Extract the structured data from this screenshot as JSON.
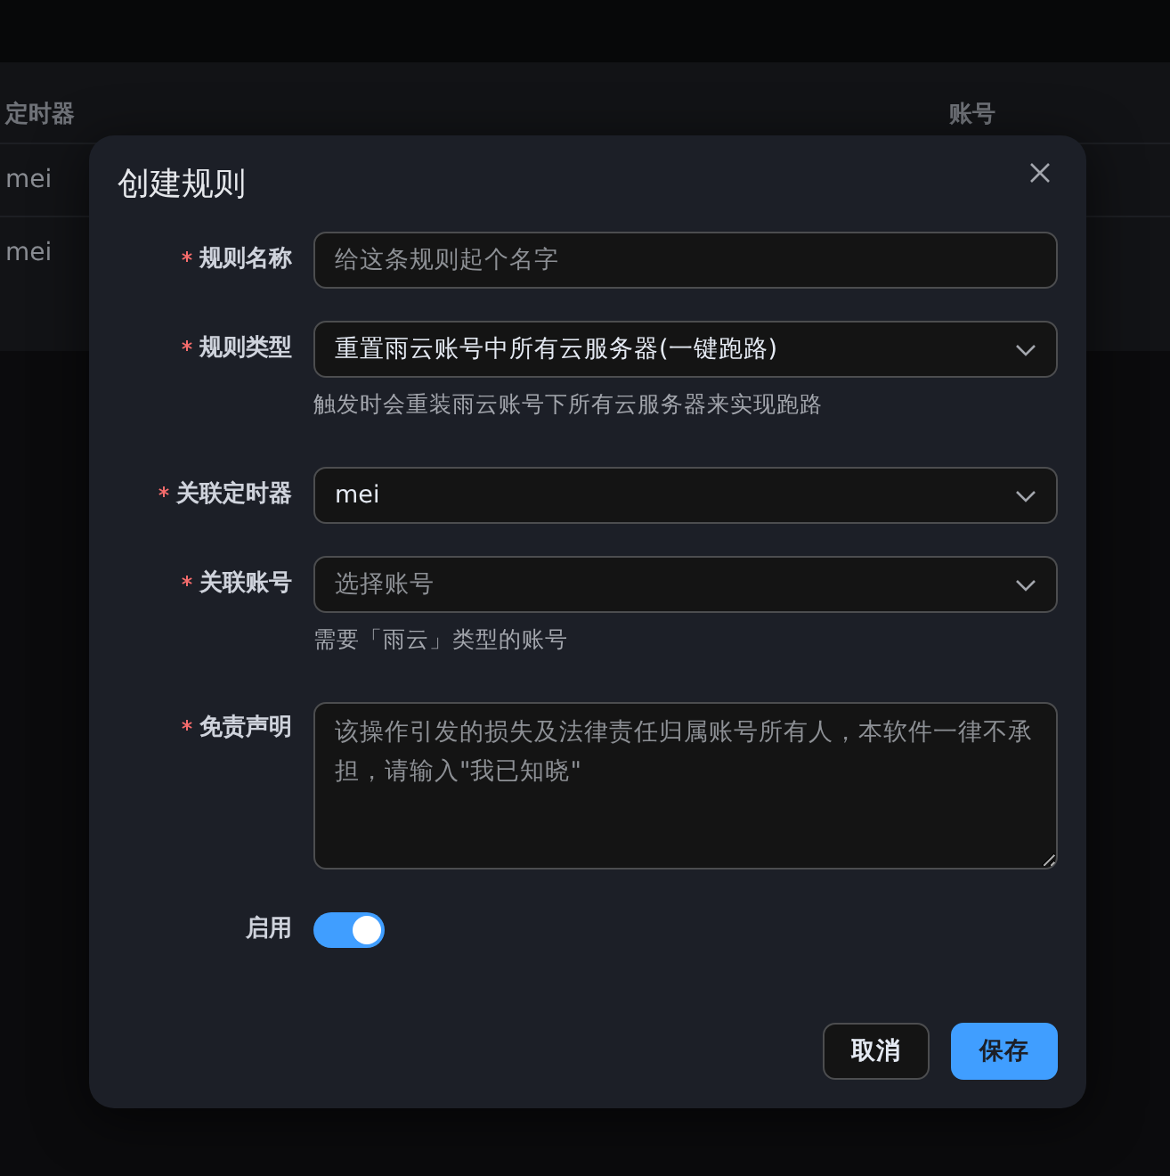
{
  "background_table": {
    "columns": [
      "定时器",
      "账号"
    ],
    "rows": [
      {
        "timer": "mei"
      },
      {
        "timer": "mei"
      }
    ]
  },
  "dialog": {
    "title": "创建规则",
    "fields": [
      {
        "kind": "input",
        "label": "规则名称",
        "required": true,
        "placeholder": "给这条规则起个名字"
      },
      {
        "kind": "select",
        "label": "规则类型",
        "required": true,
        "value": "重置雨云账号中所有云服务器(一键跑路)",
        "hint": "触发时会重装雨云账号下所有云服务器来实现跑路"
      },
      {
        "kind": "select",
        "label": "关联定时器",
        "required": true,
        "value": "mei"
      },
      {
        "kind": "select",
        "label": "关联账号",
        "required": true,
        "placeholder": "选择账号",
        "hint": "需要「雨云」类型的账号"
      },
      {
        "kind": "textarea",
        "label": "免责声明",
        "required": true,
        "placeholder": "该操作引发的损失及法律责任归属账号所有人，本软件一律不承担，请输入\"我已知晓\""
      },
      {
        "kind": "switch",
        "label": "启用",
        "required": false,
        "on": true
      }
    ],
    "buttons": [
      {
        "kind": "default",
        "label": "取消"
      },
      {
        "kind": "primary",
        "label": "保存"
      }
    ]
  }
}
